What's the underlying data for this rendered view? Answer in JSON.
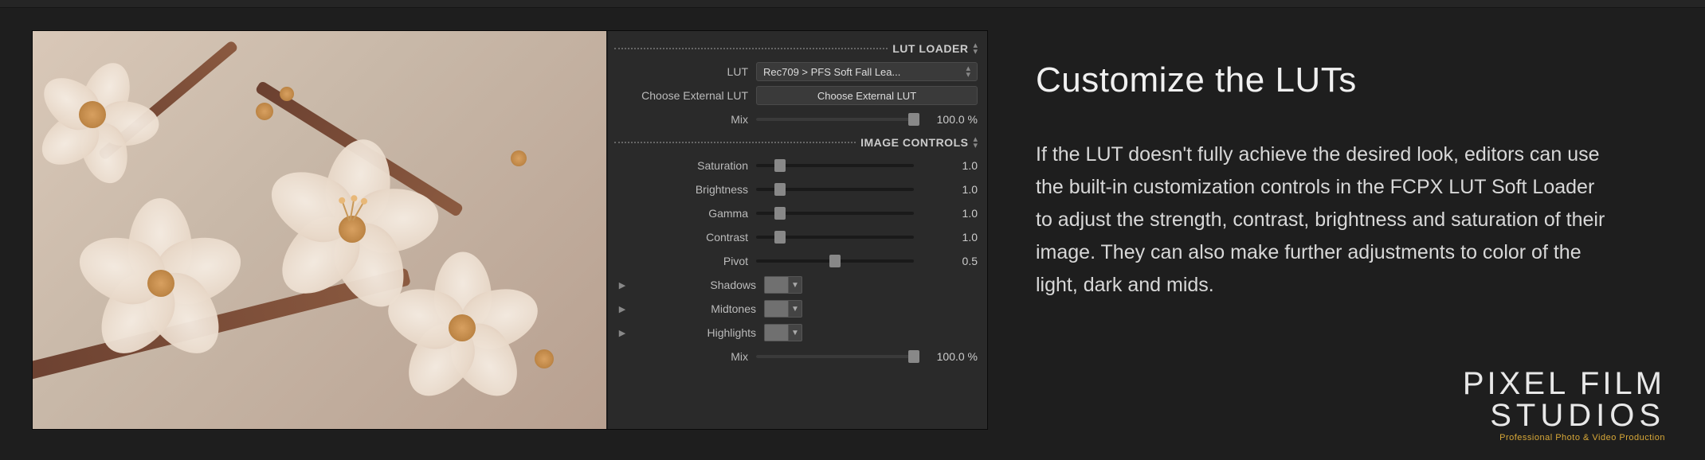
{
  "lut_loader": {
    "section_title": "LUT LOADER",
    "lut_label": "LUT",
    "lut_value": "Rec709 > PFS Soft Fall Lea...",
    "choose_label": "Choose External LUT",
    "choose_button": "Choose External LUT",
    "mix_label": "Mix",
    "mix_value": "100.0 %",
    "mix_pct": 100
  },
  "image_controls": {
    "section_title": "IMAGE CONTROLS",
    "saturation": {
      "label": "Saturation",
      "value": "1.0",
      "pct": 15
    },
    "brightness": {
      "label": "Brightness",
      "value": "1.0",
      "pct": 15
    },
    "gamma": {
      "label": "Gamma",
      "value": "1.0",
      "pct": 15
    },
    "contrast": {
      "label": "Contrast",
      "value": "1.0",
      "pct": 15
    },
    "pivot": {
      "label": "Pivot",
      "value": "0.5",
      "pct": 50
    },
    "shadows": {
      "label": "Shadows"
    },
    "midtones": {
      "label": "Midtones"
    },
    "highlights": {
      "label": "Highlights"
    },
    "mix": {
      "label": "Mix",
      "value": "100.0 %",
      "pct": 100
    }
  },
  "article": {
    "heading": "Customize the LUTs",
    "body": "If the LUT doesn't fully achieve the desired look, editors can use the built-in customization controls in the FCPX LUT Soft Loader to adjust the strength, contrast, brightness and saturation of their image. They can also make further adjustments to color of the light, dark and mids."
  },
  "brand": {
    "line1": "PIXEL FILM",
    "line2": "STUDIOS",
    "tagline": "Professional Photo & Video Production"
  }
}
